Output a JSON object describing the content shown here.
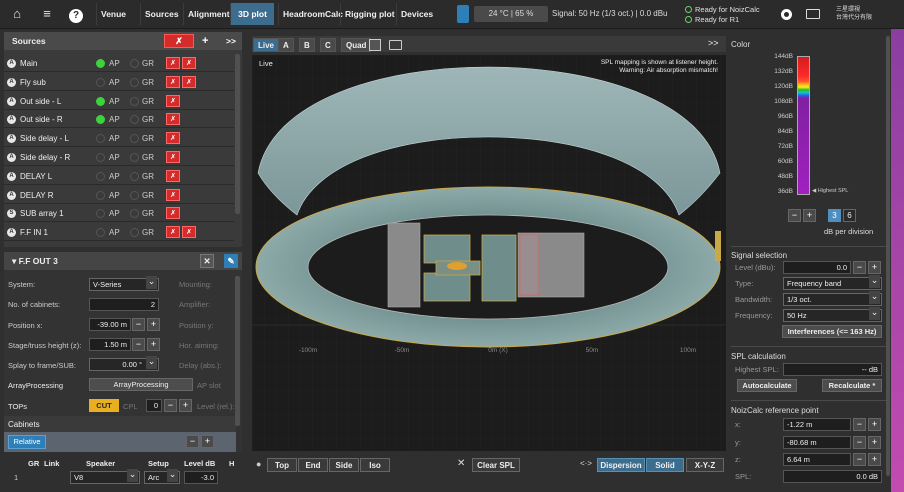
{
  "topbar": {
    "home_icon": "home-icon",
    "menu_icon": "menu-icon",
    "help_icon": "help-icon",
    "tabs": [
      "Venue",
      "Sources",
      "Alignment",
      "3D plot",
      "HeadroomCalc",
      "Rigging plot",
      "Devices"
    ],
    "active_tab": "3D plot",
    "temperature": "24 °C | 65 %",
    "signal": "Signal: 50 Hz (1/3 oct.) | 0.0 dBu",
    "ready_noizcalc": "Ready for NoizCalc",
    "ready_r1": "Ready for R1",
    "logo_line1": "三星環視",
    "logo_line2": "台灣代分有限"
  },
  "sources": {
    "title": "Sources",
    "add_label": "+",
    "expand_label": ">>",
    "rows": [
      {
        "badge": "A",
        "name": "Main",
        "ap_on": true,
        "mute_count": 2
      },
      {
        "badge": "A",
        "name": "Fly sub",
        "ap_on": false,
        "mute_count": 2
      },
      {
        "badge": "A",
        "name": "Out side - L",
        "ap_on": true,
        "mute_count": 1
      },
      {
        "badge": "A",
        "name": "Out side - R",
        "ap_on": true,
        "mute_count": 1
      },
      {
        "badge": "A",
        "name": "Side delay - L",
        "ap_on": false,
        "mute_count": 1
      },
      {
        "badge": "A",
        "name": "Side delay - R",
        "ap_on": false,
        "mute_count": 1
      },
      {
        "badge": "A",
        "name": "DELAY  L",
        "ap_on": false,
        "mute_count": 1
      },
      {
        "badge": "A",
        "name": "DELAY R",
        "ap_on": false,
        "mute_count": 1
      },
      {
        "badge": "S",
        "name": "SUB array 1",
        "ap_on": false,
        "mute_count": 1
      },
      {
        "badge": "A",
        "name": "F.F IN 1",
        "ap_on": false,
        "mute_count": 2
      }
    ],
    "ap_label": "AP",
    "gr_label": "GR",
    "mute_glyph": "✗"
  },
  "props": {
    "title": "F.F OUT 3",
    "system_label": "System:",
    "system_value": "V-Series",
    "mounting_label": "Mounting:",
    "cabinets_label": "No. of cabinets:",
    "cabinets_value": "2",
    "amplifier_label": "Amplifier:",
    "posx_label": "Position x:",
    "posx_value": "-39.00 m",
    "posy_label": "Position y:",
    "stage_label": "Stage/truss height (z):",
    "stage_value": "1.50 m",
    "horaim_label": "Hor. aiming:",
    "splay_label": "Splay to frame/SUB:",
    "splay_value": "0.00 °",
    "delay_label": "Delay (abs.):",
    "arrayproc_label": "ArrayProcessing",
    "arrayproc_btn": "ArrayProcessing",
    "apslot_label": "AP slot",
    "tops_label": "TOPs",
    "cut_label": "CUT",
    "cpl_label": "CPL",
    "cpl_value": "0",
    "level_label": "Level (rel.):",
    "cabinets_section": "Cabinets",
    "relative_label": "Relative",
    "table_headers": [
      "GR",
      "Link",
      "Speaker",
      "Setup",
      "Level dB",
      "H"
    ],
    "table_row": {
      "idx": "1",
      "speaker": "V8",
      "setup": "Arc",
      "level": "-3.0"
    }
  },
  "view": {
    "tabs": [
      "Live",
      "A",
      "B",
      "C",
      "Quad"
    ],
    "active_tab": "Live",
    "live_label": "Live",
    "note_line1": "SPL mapping is shown at listener height.",
    "note_line2": "Warning: Air absorption mismatch!",
    "axis_labels": [
      "-100m",
      "-50m",
      "0m (X)",
      "50m",
      "100m"
    ],
    "bottom_buttons": [
      "Top",
      "End",
      "Side",
      "Iso"
    ],
    "clear_spl": "Clear SPL",
    "render_buttons": [
      "Dispersion",
      "Solid",
      "X-Y-Z"
    ],
    "active_render": [
      "Dispersion",
      "Solid"
    ]
  },
  "color_panel": {
    "title": "Color",
    "scale": [
      "144dB",
      "132dB",
      "120dB",
      "108dB",
      "96dB",
      "84dB",
      "72dB",
      "60dB",
      "48dB",
      "36dB"
    ],
    "highest_label": "Highest SPL",
    "per_div_values": [
      "3",
      "6"
    ],
    "per_div_selected": "3",
    "per_div_label": "dB per division"
  },
  "signal_selection": {
    "title": "Signal selection",
    "level_label": "Level (dBu):",
    "level_value": "0.0",
    "type_label": "Type:",
    "type_value": "Frequency band",
    "bandwidth_label": "Bandwidth:",
    "bandwidth_value": "1/3 oct.",
    "frequency_label": "Frequency:",
    "frequency_value": "50 Hz",
    "interferences_btn": "Interferences (<= 163 Hz)"
  },
  "spl_calc": {
    "title": "SPL calculation",
    "highest_label": "Highest SPL:",
    "highest_value": "-- dB",
    "autocalc_btn": "Autocalculate",
    "recalc_btn": "Recalculate *"
  },
  "noizcalc": {
    "title": "NoizCalc reference point",
    "x_label": "x:",
    "x_value": "-1.22 m",
    "y_label": "y:",
    "y_value": "-80.68 m",
    "z_label": "z:",
    "z_value": "6.64 m",
    "spl_label": "SPL:",
    "spl_value": "0.0 dB"
  }
}
